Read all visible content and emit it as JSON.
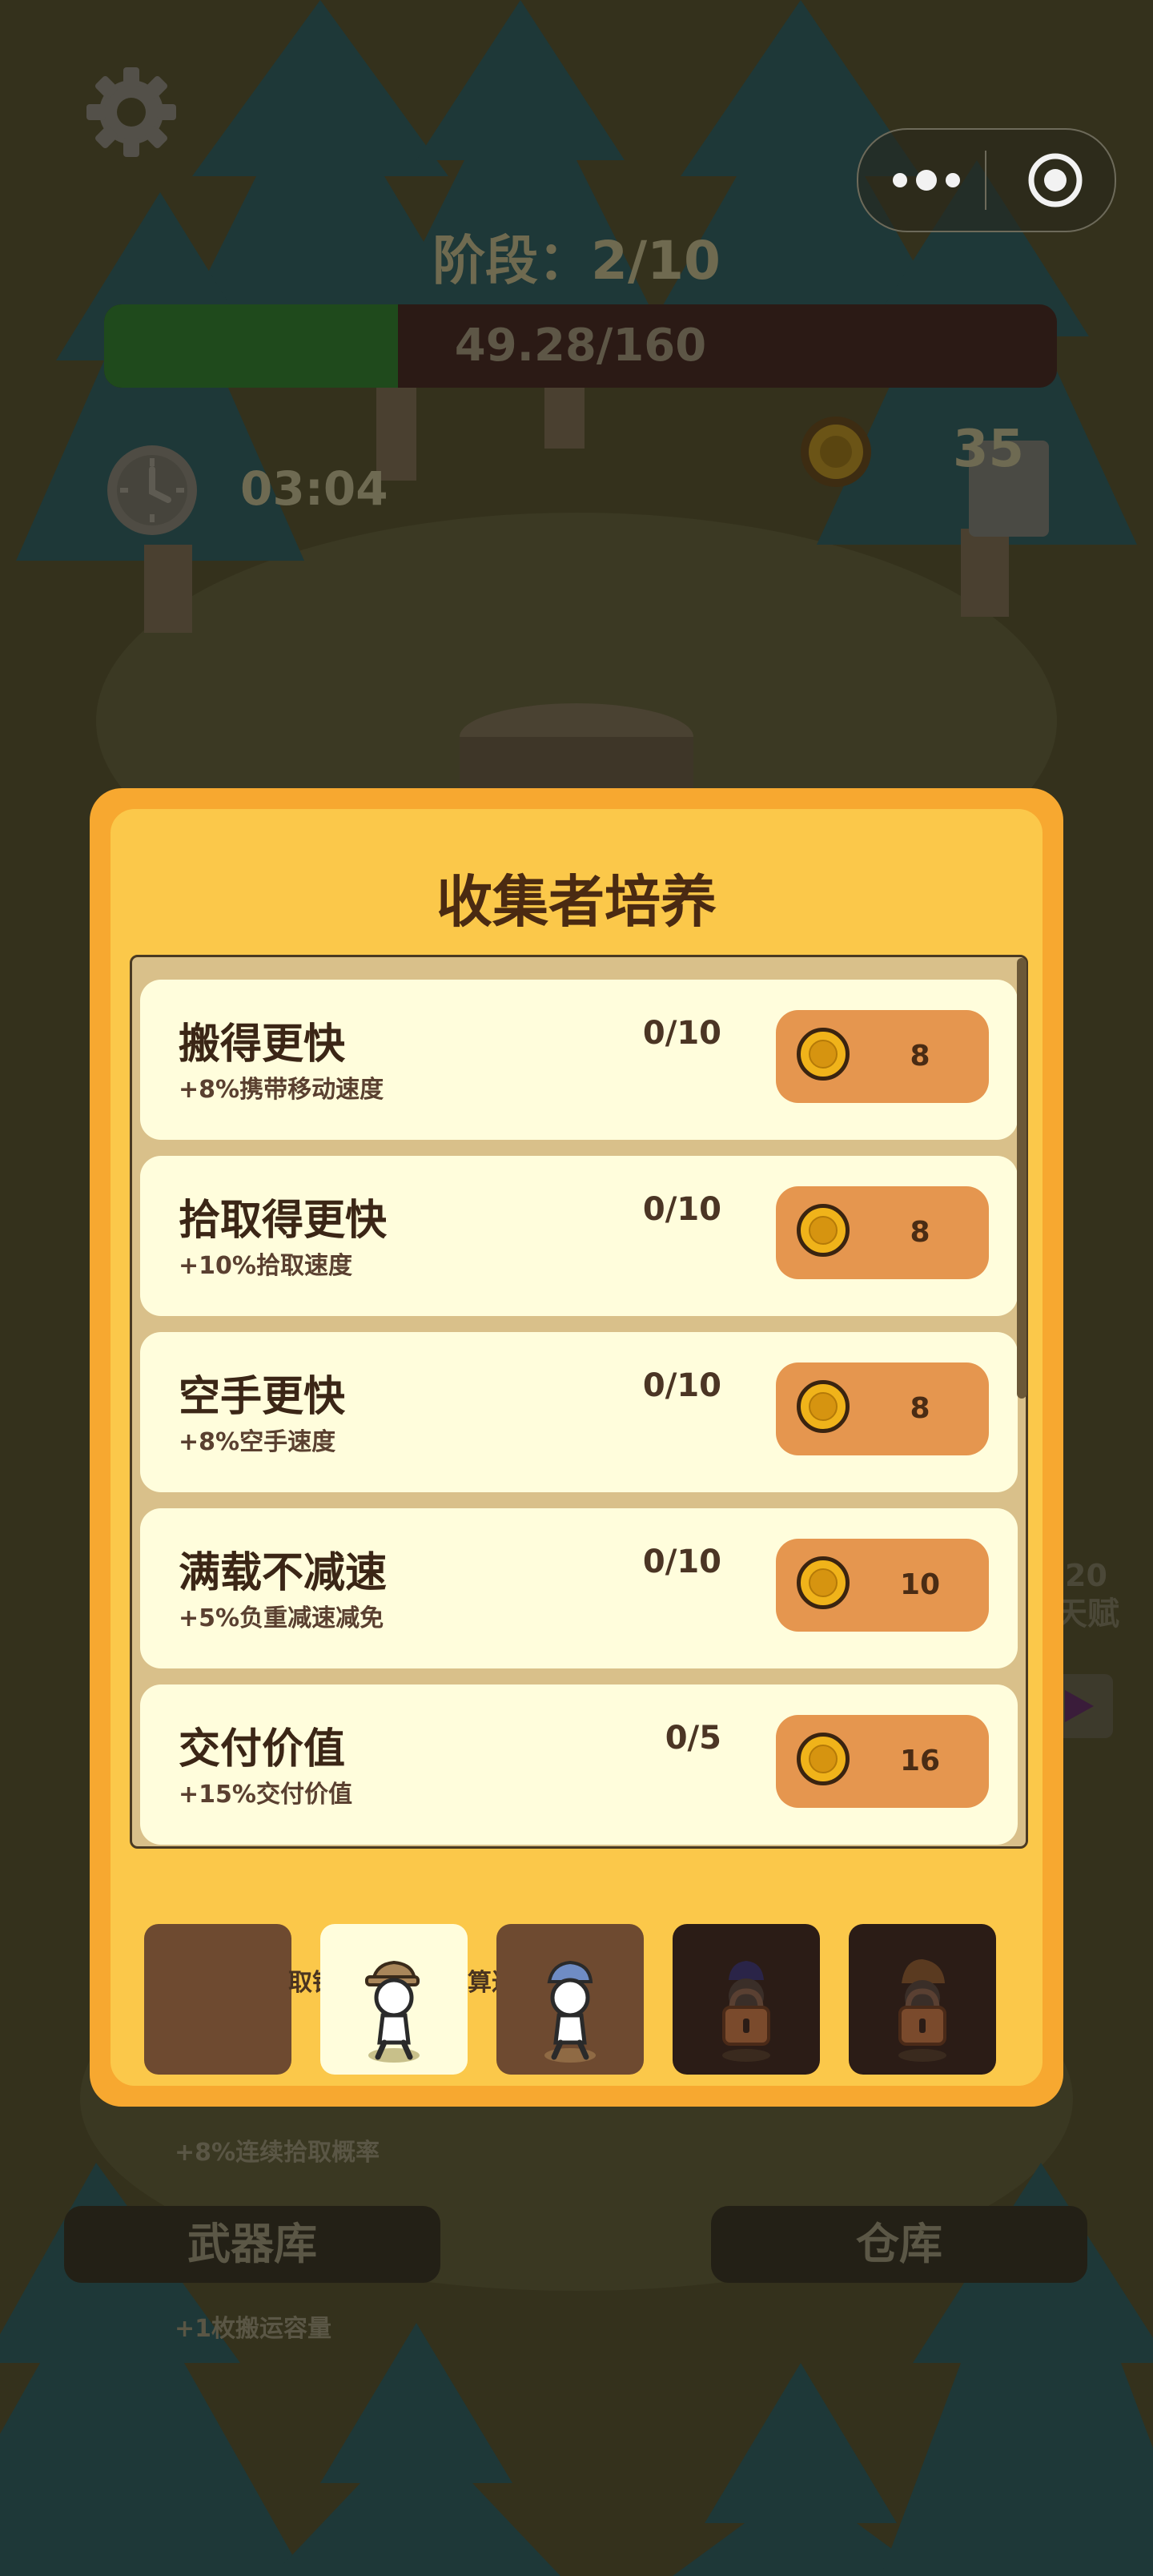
{
  "hud": {
    "stage_label": "阶段：2/10",
    "progress": {
      "current": 49.28,
      "max": 160,
      "text": "49.28/160"
    },
    "timer": "03:04",
    "wood_count": "35"
  },
  "background": {
    "side_labels": [
      "20",
      "天赋"
    ],
    "note_1": "+8%连续拾取概率",
    "note_2": "+1枚搬运容量",
    "button_armory": "武器库",
    "button_warehouse": "仓库",
    "partial_text_left": "取银",
    "partial_text_right": "算达"
  },
  "dialog": {
    "title": "收集者培养",
    "upgrades": [
      {
        "name": "搬得更快",
        "desc": "+8%携带移动速度",
        "level": "0/10",
        "cost": "8"
      },
      {
        "name": "拾取得更快",
        "desc": "+10%拾取速度",
        "level": "0/10",
        "cost": "8"
      },
      {
        "name": "空手更快",
        "desc": "+8%空手速度",
        "level": "0/10",
        "cost": "8"
      },
      {
        "name": "满载不减速",
        "desc": "+5%负重减速减免",
        "level": "0/10",
        "cost": "10"
      },
      {
        "name": "交付价值",
        "desc": "+15%交付价值",
        "level": "0/5",
        "cost": "16"
      }
    ]
  },
  "colors": {
    "dialog_outer": "#f7a830",
    "dialog_inner": "#fbc84a",
    "row_bg": "#fffddc",
    "buy_button": "#e5964f",
    "coin": "#f0b31a",
    "overlay_dim": "#33301c"
  },
  "icons": [
    "gear-icon",
    "clock-icon",
    "coin-icon",
    "wood-log-icon",
    "more-dots-icon",
    "target-icon",
    "lock-icon",
    "collector-character-icon"
  ]
}
